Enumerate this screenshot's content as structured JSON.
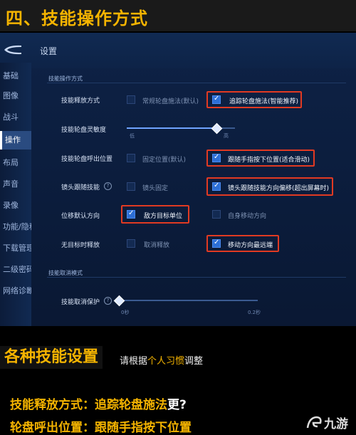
{
  "heading": "四、技能操作方式",
  "game": {
    "page_title": "设置",
    "sidebar": [
      "基础",
      "图像",
      "战斗",
      "操作",
      "布局",
      "声音",
      "录像",
      "功能/隐私",
      "下载管理",
      "二级密码",
      "网络诊断"
    ],
    "active_sidebar_index": 3,
    "section1": "技能操作方式",
    "section2": "技能取消模式",
    "rows": {
      "cast_mode": {
        "label": "技能释放方式",
        "opt1": "常规轮盘施法(默认)",
        "opt2": "追踪轮盘施法(智能推荐)"
      },
      "sensitivity": {
        "label": "技能轮盘灵敏度",
        "low": "低",
        "high": "高",
        "value": 0.82
      },
      "call_pos": {
        "label": "技能轮盘呼出位置",
        "opt1": "固定位置(默认)",
        "opt2": "跟随手指按下位置(适合滑动)"
      },
      "camera": {
        "label": "镜头跟随技能",
        "opt1": "镜头固定",
        "opt2": "镜头跟随技能方向偏移(超出屏幕时)"
      },
      "displace": {
        "label": "位移默认方向",
        "opt1": "敌方目标单位",
        "opt2": "自身移动方向"
      },
      "no_target": {
        "label": "无目标时释放",
        "opt1": "取消释放",
        "opt2": "移动方向最远端"
      },
      "cancel": {
        "label": "技能取消保护",
        "min": "0秒",
        "max": "0.2秒",
        "value": 0.0
      }
    }
  },
  "bottom": {
    "title": "各种技能设置",
    "sub_pre": "请根据",
    "sub_hl": "个人习惯",
    "sub_post": "调整",
    "line1_key": "技能释放方式：",
    "line1_val": "追踪轮盘施法",
    "line1_tail": "更?",
    "line2_key": "轮盘呼出位置：",
    "line2_val": "跟随手指按下位置",
    "logo_text": "九游"
  }
}
